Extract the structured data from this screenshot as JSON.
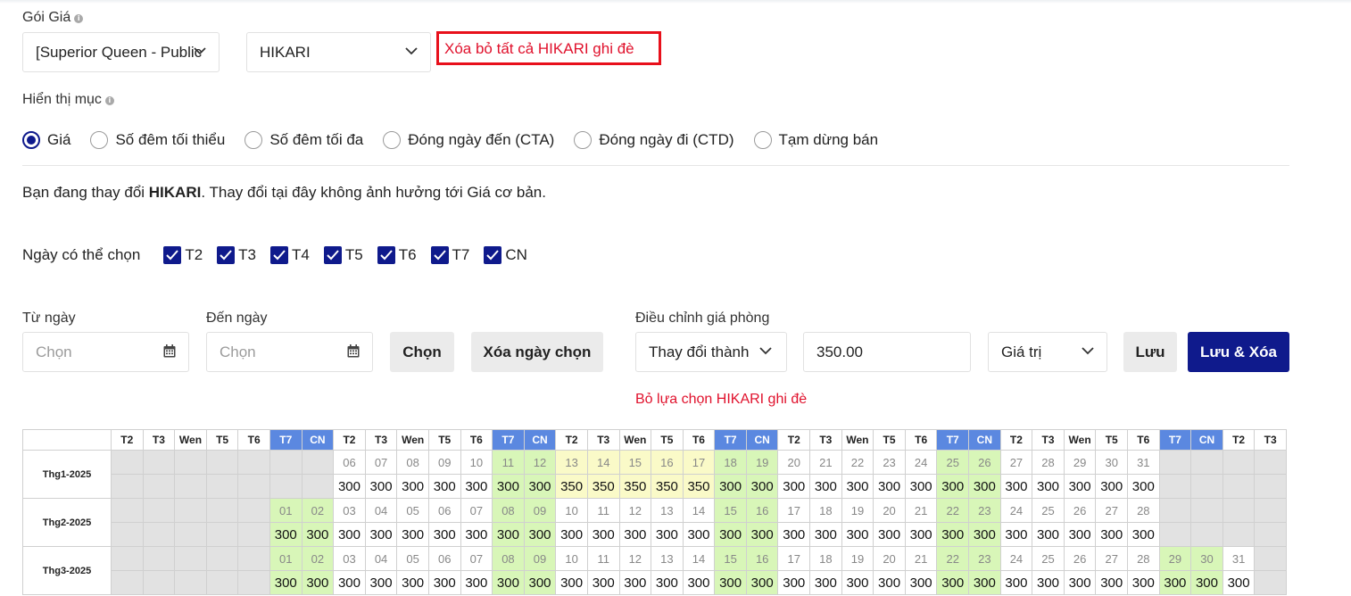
{
  "goi_gia": {
    "label": "Gói Giá",
    "room_select": "[Superior Queen - Public",
    "plan_select": "HIKARI",
    "clear_all_link": "Xóa bỏ tất cả HIKARI ghi đè"
  },
  "display": {
    "label": "Hiển thị mục",
    "options": [
      {
        "label": "Giá",
        "selected": true
      },
      {
        "label": "Số đêm tối thiểu",
        "selected": false
      },
      {
        "label": "Số đêm tối đa",
        "selected": false
      },
      {
        "label": "Đóng ngày đến (CTA)",
        "selected": false
      },
      {
        "label": "Đóng ngày đi (CTD)",
        "selected": false
      },
      {
        "label": "Tạm dừng bán",
        "selected": false
      }
    ]
  },
  "notice": {
    "prefix": "Bạn đang thay đổi ",
    "bold": "HIKARI",
    "suffix": ". Thay đổi tại đây không ảnh hưởng tới Giá cơ bản."
  },
  "weekdays": {
    "label": "Ngày có thể chọn",
    "items": [
      "T2",
      "T3",
      "T4",
      "T5",
      "T6",
      "T7",
      "CN"
    ]
  },
  "form": {
    "from_label": "Từ ngày",
    "from_placeholder": "Chọn",
    "to_label": "Đến ngày",
    "to_placeholder": "Chọn",
    "choose_button": "Chọn",
    "clear_dates_button": "Xóa ngày chọn",
    "adjust_label": "Điều chỉnh giá phòng",
    "adjust_mode": "Thay đổi thành",
    "amount": "350.00",
    "value_type": "Giá trị",
    "save_button": "Lưu",
    "save_clear_button": "Lưu & Xóa",
    "deselect_link": "Bỏ lựa chọn HIKARI ghi đè"
  },
  "colors": {
    "primary": "#0f1a8c",
    "weekend_header": "#5b88e0",
    "weekend_cell": "#d8f6b8",
    "highlight_cell": "#fafac8",
    "empty_cell": "#e2e2e2",
    "alert_red": "#e0112c"
  },
  "calendar": {
    "headers": [
      "T2",
      "T3",
      "Wen",
      "T5",
      "T6",
      "T7",
      "CN",
      "T2",
      "T3",
      "Wen",
      "T5",
      "T6",
      "T7",
      "CN",
      "T2",
      "T3",
      "Wen",
      "T5",
      "T6",
      "T7",
      "CN",
      "T2",
      "T3",
      "Wen",
      "T5",
      "T6",
      "T7",
      "CN",
      "T2",
      "T3",
      "Wen",
      "T5",
      "T6",
      "T7",
      "CN",
      "T2",
      "T3"
    ],
    "months": [
      {
        "name": "Thg1-2025",
        "cells": [
          null,
          null,
          null,
          null,
          null,
          null,
          null,
          {
            "d": "06",
            "v": "300"
          },
          {
            "d": "07",
            "v": "300"
          },
          {
            "d": "08",
            "v": "300"
          },
          {
            "d": "09",
            "v": "300"
          },
          {
            "d": "10",
            "v": "300"
          },
          {
            "d": "11",
            "v": "300"
          },
          {
            "d": "12",
            "v": "300"
          },
          {
            "d": "13",
            "v": "350",
            "h": true
          },
          {
            "d": "14",
            "v": "350",
            "h": true
          },
          {
            "d": "15",
            "v": "350",
            "h": true
          },
          {
            "d": "16",
            "v": "350",
            "h": true
          },
          {
            "d": "17",
            "v": "350",
            "h": true
          },
          {
            "d": "18",
            "v": "300"
          },
          {
            "d": "19",
            "v": "300"
          },
          {
            "d": "20",
            "v": "300"
          },
          {
            "d": "21",
            "v": "300"
          },
          {
            "d": "22",
            "v": "300"
          },
          {
            "d": "23",
            "v": "300"
          },
          {
            "d": "24",
            "v": "300"
          },
          {
            "d": "25",
            "v": "300"
          },
          {
            "d": "26",
            "v": "300"
          },
          {
            "d": "27",
            "v": "300"
          },
          {
            "d": "28",
            "v": "300"
          },
          {
            "d": "29",
            "v": "300"
          },
          {
            "d": "30",
            "v": "300"
          },
          {
            "d": "31",
            "v": "300"
          },
          null,
          null,
          null,
          null
        ]
      },
      {
        "name": "Thg2-2025",
        "cells": [
          null,
          null,
          null,
          null,
          null,
          {
            "d": "01",
            "v": "300"
          },
          {
            "d": "02",
            "v": "300"
          },
          {
            "d": "03",
            "v": "300"
          },
          {
            "d": "04",
            "v": "300"
          },
          {
            "d": "05",
            "v": "300"
          },
          {
            "d": "06",
            "v": "300"
          },
          {
            "d": "07",
            "v": "300"
          },
          {
            "d": "08",
            "v": "300"
          },
          {
            "d": "09",
            "v": "300"
          },
          {
            "d": "10",
            "v": "300"
          },
          {
            "d": "11",
            "v": "300"
          },
          {
            "d": "12",
            "v": "300"
          },
          {
            "d": "13",
            "v": "300"
          },
          {
            "d": "14",
            "v": "300"
          },
          {
            "d": "15",
            "v": "300"
          },
          {
            "d": "16",
            "v": "300"
          },
          {
            "d": "17",
            "v": "300"
          },
          {
            "d": "18",
            "v": "300"
          },
          {
            "d": "19",
            "v": "300"
          },
          {
            "d": "20",
            "v": "300"
          },
          {
            "d": "21",
            "v": "300"
          },
          {
            "d": "22",
            "v": "300"
          },
          {
            "d": "23",
            "v": "300"
          },
          {
            "d": "24",
            "v": "300"
          },
          {
            "d": "25",
            "v": "300"
          },
          {
            "d": "26",
            "v": "300"
          },
          {
            "d": "27",
            "v": "300"
          },
          {
            "d": "28",
            "v": "300"
          },
          null,
          null,
          null,
          null
        ]
      },
      {
        "name": "Thg3-2025",
        "cells": [
          null,
          null,
          null,
          null,
          null,
          {
            "d": "01",
            "v": "300"
          },
          {
            "d": "02",
            "v": "300"
          },
          {
            "d": "03",
            "v": "300"
          },
          {
            "d": "04",
            "v": "300"
          },
          {
            "d": "05",
            "v": "300"
          },
          {
            "d": "06",
            "v": "300"
          },
          {
            "d": "07",
            "v": "300"
          },
          {
            "d": "08",
            "v": "300"
          },
          {
            "d": "09",
            "v": "300"
          },
          {
            "d": "10",
            "v": "300"
          },
          {
            "d": "11",
            "v": "300"
          },
          {
            "d": "12",
            "v": "300"
          },
          {
            "d": "13",
            "v": "300"
          },
          {
            "d": "14",
            "v": "300"
          },
          {
            "d": "15",
            "v": "300"
          },
          {
            "d": "16",
            "v": "300"
          },
          {
            "d": "17",
            "v": "300"
          },
          {
            "d": "18",
            "v": "300"
          },
          {
            "d": "19",
            "v": "300"
          },
          {
            "d": "20",
            "v": "300"
          },
          {
            "d": "21",
            "v": "300"
          },
          {
            "d": "22",
            "v": "300"
          },
          {
            "d": "23",
            "v": "300"
          },
          {
            "d": "24",
            "v": "300"
          },
          {
            "d": "25",
            "v": "300"
          },
          {
            "d": "26",
            "v": "300"
          },
          {
            "d": "27",
            "v": "300"
          },
          {
            "d": "28",
            "v": "300"
          },
          {
            "d": "29",
            "v": "300"
          },
          {
            "d": "30",
            "v": "300"
          },
          {
            "d": "31",
            "v": "300"
          },
          null
        ]
      }
    ]
  }
}
